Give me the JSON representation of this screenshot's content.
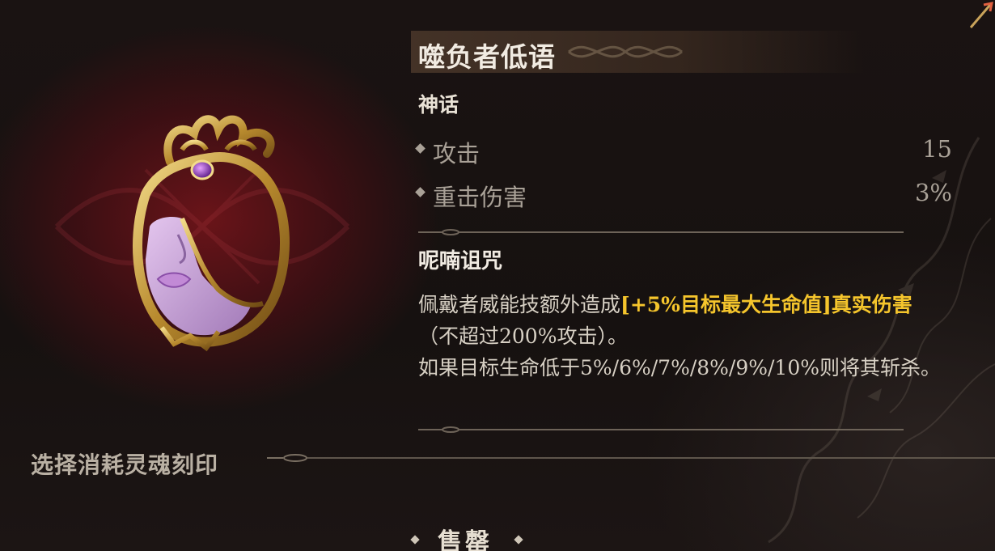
{
  "item": {
    "name": "噬负者低语",
    "rarity": "神话",
    "icon": "mask-icon"
  },
  "stats": [
    {
      "label": "攻击",
      "value": "15"
    },
    {
      "label": "重击伤害",
      "value": "3%"
    }
  ],
  "skill": {
    "name": "呢喃诅咒",
    "desc_part1": "佩戴者威能技额外造成",
    "desc_highlight1": "[+5%目标最大生命值]真实伤害",
    "desc_part2": "（不超过200%攻击）。",
    "desc_line2": "如果目标生命低于5%/6%/7%/8%/9%/10%则将其斩杀。"
  },
  "select_label": "选择消耗灵魂刻印",
  "sell_button": "售罄",
  "colors": {
    "highlight": "#f5c52c",
    "accent_red": "#6a1419",
    "text_main": "#f1ebe2",
    "text_dim": "#a9a197"
  }
}
